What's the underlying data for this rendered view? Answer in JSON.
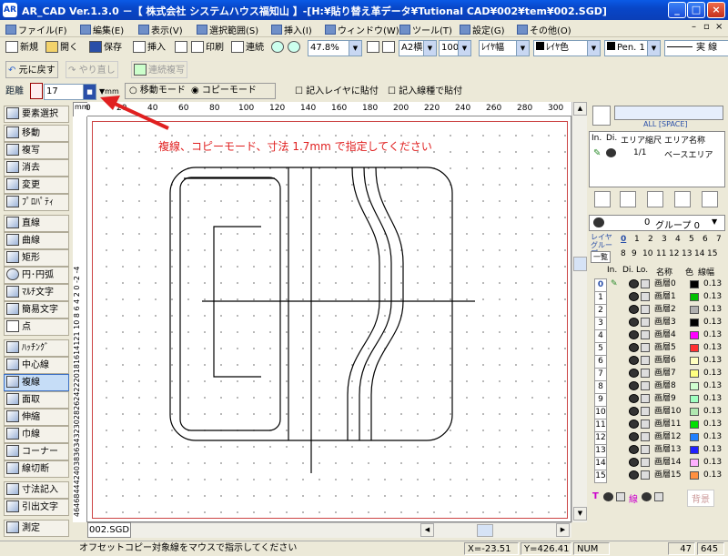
{
  "window": {
    "title": "AR_CAD Ver.1.3.0 －【 株式会社 システムハウス福知山 】-[H:¥貼り替え革データ¥Tutional CAD¥002¥tem¥002.SGD]",
    "app_icon_text": "AR"
  },
  "menu": [
    {
      "label": "ファイル(F)"
    },
    {
      "label": "編集(E)"
    },
    {
      "label": "表示(V)"
    },
    {
      "label": "選択範囲(S)"
    },
    {
      "label": "挿入(I)"
    },
    {
      "label": "ウィンドウ(W)"
    },
    {
      "label": "ツール(T)"
    },
    {
      "label": "設定(G)"
    },
    {
      "label": "その他(O)"
    }
  ],
  "toolbar": {
    "new": "新規",
    "open": "開く",
    "save": "保存",
    "insert": "挿入",
    "print": "印刷",
    "continuous": "連続",
    "zoom": "47.8%",
    "paper": "A2横",
    "scale": "100",
    "layer_width": "ﾚｲﾔ幅",
    "layer_color": "ﾚｲﾔ色",
    "pen": "Pen. 1",
    "line_type": "実 線"
  },
  "undo_bar": {
    "undo": "元に戻す",
    "redo": "やり直し",
    "repeat": "連続複写"
  },
  "distance_bar": {
    "label": "距離",
    "value": "17",
    "unit": "mm",
    "mode_move": "移動モード",
    "mode_copy": "コピーモード",
    "check_paste_layer": "記入レイヤに貼付",
    "check_paste_linetype": "記入線種で貼付"
  },
  "tools": [
    "要素選択",
    "移動",
    "複写",
    "消去",
    "変更",
    "ﾌﾟﾛﾊﾟﾃｨ",
    "直線",
    "曲線",
    "矩形",
    "円･円弧",
    "ﾏﾙﾁ文字",
    "簡易文字",
    "点",
    "ﾊｯﾁﾝｸﾞ",
    "中心線",
    "複線",
    "面取",
    "伸縮",
    "巾線",
    "コーナー",
    "線切断",
    "寸法記入",
    "引出文字",
    "測定"
  ],
  "ruler_top": [
    "0",
    "20",
    "40",
    "60",
    "80",
    "100",
    "120",
    "140",
    "160",
    "180",
    "200",
    "220",
    "240",
    "260",
    "280",
    "300"
  ],
  "ruler_left": "4646844424038363432302826242220181614121 10 8 6 4 2 0 -2 -4",
  "annotation": "複線、コピーモード、寸法 1.7mm で指定してください",
  "document_tab": "002.SGD",
  "area_panel": {
    "headers": [
      "In.",
      "Di.",
      "エリア縮尺",
      "エリア名称"
    ],
    "row": {
      "scale": "1/1",
      "name": "ベースエリア"
    },
    "all_label": "ALL [SPACE]"
  },
  "layer_panel": {
    "group_label": "グループ 0",
    "group_num": "0",
    "group_caption": "レイヤ グループ",
    "list_btn": "一覧",
    "group_numbers": [
      "0",
      "1",
      "2",
      "3",
      "4",
      "5",
      "6",
      "7",
      "8",
      "9",
      "10",
      "11",
      "12",
      "13",
      "14",
      "15"
    ],
    "headers": [
      "In.",
      "Di.",
      "Lo.",
      "名称",
      "色",
      "線幅"
    ],
    "layers": [
      {
        "num": "0",
        "name": "画層0",
        "color": "#000000",
        "width": "0.13"
      },
      {
        "num": "1",
        "name": "画層1",
        "color": "#00c000",
        "width": "0.13"
      },
      {
        "num": "2",
        "name": "画層2",
        "color": "#b0b0b0",
        "width": "0.13"
      },
      {
        "num": "3",
        "name": "画層3",
        "color": "#000000",
        "width": "0.13"
      },
      {
        "num": "4",
        "name": "画層4",
        "color": "#ff00ff",
        "width": "0.13"
      },
      {
        "num": "5",
        "name": "画層5",
        "color": "#ff3030",
        "width": "0.13"
      },
      {
        "num": "6",
        "name": "画層6",
        "color": "#ffffc0",
        "width": "0.13"
      },
      {
        "num": "7",
        "name": "画層7",
        "color": "#ffff80",
        "width": "0.13"
      },
      {
        "num": "8",
        "name": "画層8",
        "color": "#d0ffd0",
        "width": "0.13"
      },
      {
        "num": "9",
        "name": "画層9",
        "color": "#a0ffc0",
        "width": "0.13"
      },
      {
        "num": "10",
        "name": "画層10",
        "color": "#b0e8b0",
        "width": "0.13"
      },
      {
        "num": "11",
        "name": "画層11",
        "color": "#00e000",
        "width": "0.13"
      },
      {
        "num": "12",
        "name": "画層12",
        "color": "#2080ff",
        "width": "0.13"
      },
      {
        "num": "13",
        "name": "画層13",
        "color": "#2020ff",
        "width": "0.13"
      },
      {
        "num": "14",
        "name": "画層14",
        "color": "#ffb0ff",
        "width": "0.13"
      },
      {
        "num": "15",
        "name": "画層15",
        "color": "#ff9040",
        "width": "0.13"
      }
    ],
    "footer": {
      "t": "T",
      "line": "線",
      "bg": "背景"
    }
  },
  "status": {
    "message": "オフセットコピー対象線をマウスで指示してください",
    "x": "X=-23.51",
    "y": "Y=426.41",
    "num": "NUM",
    "count": "47",
    "size": "645"
  }
}
